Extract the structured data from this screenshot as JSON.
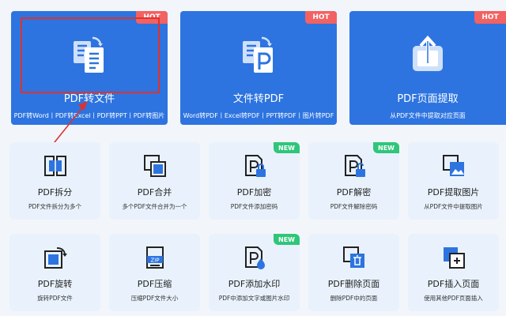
{
  "top_cards": [
    {
      "title": "PDF转文件",
      "sub": "PDF转Word丨PDF转Excel丨PDF转PPT丨PDF转图片",
      "badge": "HOT",
      "icon": "doc-convert-icon"
    },
    {
      "title": "文件转PDF",
      "sub": "Word转PDF丨Excel转PDF丨PPT转PDF丨图片转PDF",
      "badge": "HOT",
      "icon": "file-to-pdf-icon"
    },
    {
      "title": "PDF页面提取",
      "sub": "从PDF文件中提取对应页面",
      "badge": "HOT",
      "icon": "extract-icon"
    }
  ],
  "row1": [
    {
      "title": "PDF拆分",
      "sub": "PDF文件拆分为多个",
      "icon": "split-icon"
    },
    {
      "title": "PDF合并",
      "sub": "多个PDF文件合并为一个",
      "icon": "merge-icon"
    },
    {
      "title": "PDF加密",
      "sub": "PDF文件添加密码",
      "badge": "NEW",
      "icon": "lock-icon"
    },
    {
      "title": "PDF解密",
      "sub": "PDF文件解除密码",
      "badge": "NEW",
      "icon": "unlock-icon"
    },
    {
      "title": "PDF提取图片",
      "sub": "从PDF文件中提取图片",
      "icon": "image-icon"
    }
  ],
  "row2": [
    {
      "title": "PDF旋转",
      "sub": "旋转PDF文件",
      "icon": "rotate-icon"
    },
    {
      "title": "PDF压缩",
      "sub": "压缩PDF文件大小",
      "icon": "zip-icon"
    },
    {
      "title": "PDF添加水印",
      "sub": "PDF中添加文字或图片水印",
      "badge": "NEW",
      "icon": "watermark-icon"
    },
    {
      "title": "PDF删除页面",
      "sub": "删除PDF中的页面",
      "icon": "trash-icon"
    },
    {
      "title": "PDF插入页面",
      "sub": "使用其他PDF页面插入",
      "icon": "insert-icon"
    }
  ],
  "colors": {
    "primary": "#2d74e0",
    "hot": "#f26262",
    "new": "#2fc67a",
    "card": "#e9f2fc",
    "highlight": "#e0322c"
  }
}
